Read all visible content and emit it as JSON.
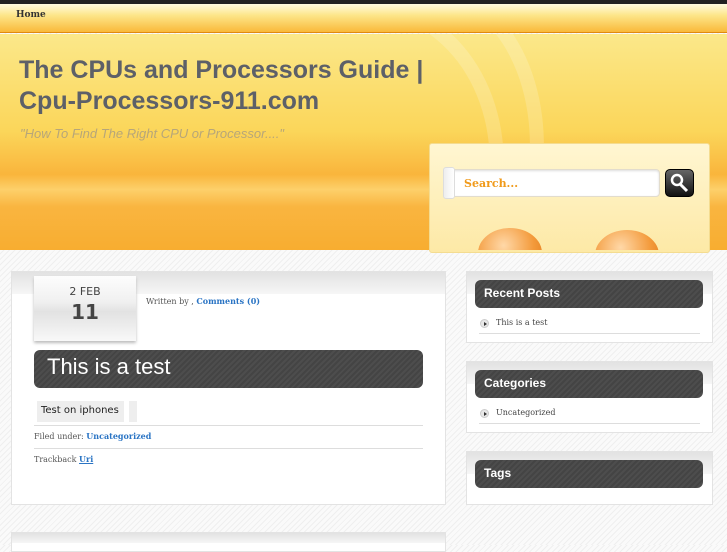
{
  "nav": {
    "home": "Home"
  },
  "header": {
    "title": "The CPUs and Processors Guide | Cpu-Processors-911.com",
    "tagline": "\"How To Find The Right CPU or Processor....\""
  },
  "search": {
    "placeholder": "Search..."
  },
  "post": {
    "date_month": "2 FEB",
    "date_day": "11",
    "written_by": "Written by ,",
    "comments": "Comments (0)",
    "title": "This is a test",
    "tag": "Test on iphones",
    "filed_label": "Filed under:",
    "category": "Uncategorized",
    "trackback_label": "Trackback",
    "trackback_link": "Uri"
  },
  "sidebar": {
    "recent_title": "Recent Posts",
    "recent_items": [
      "This is a test"
    ],
    "categories_title": "Categories",
    "category_items": [
      "Uncategorized"
    ],
    "tags_title": "Tags"
  }
}
